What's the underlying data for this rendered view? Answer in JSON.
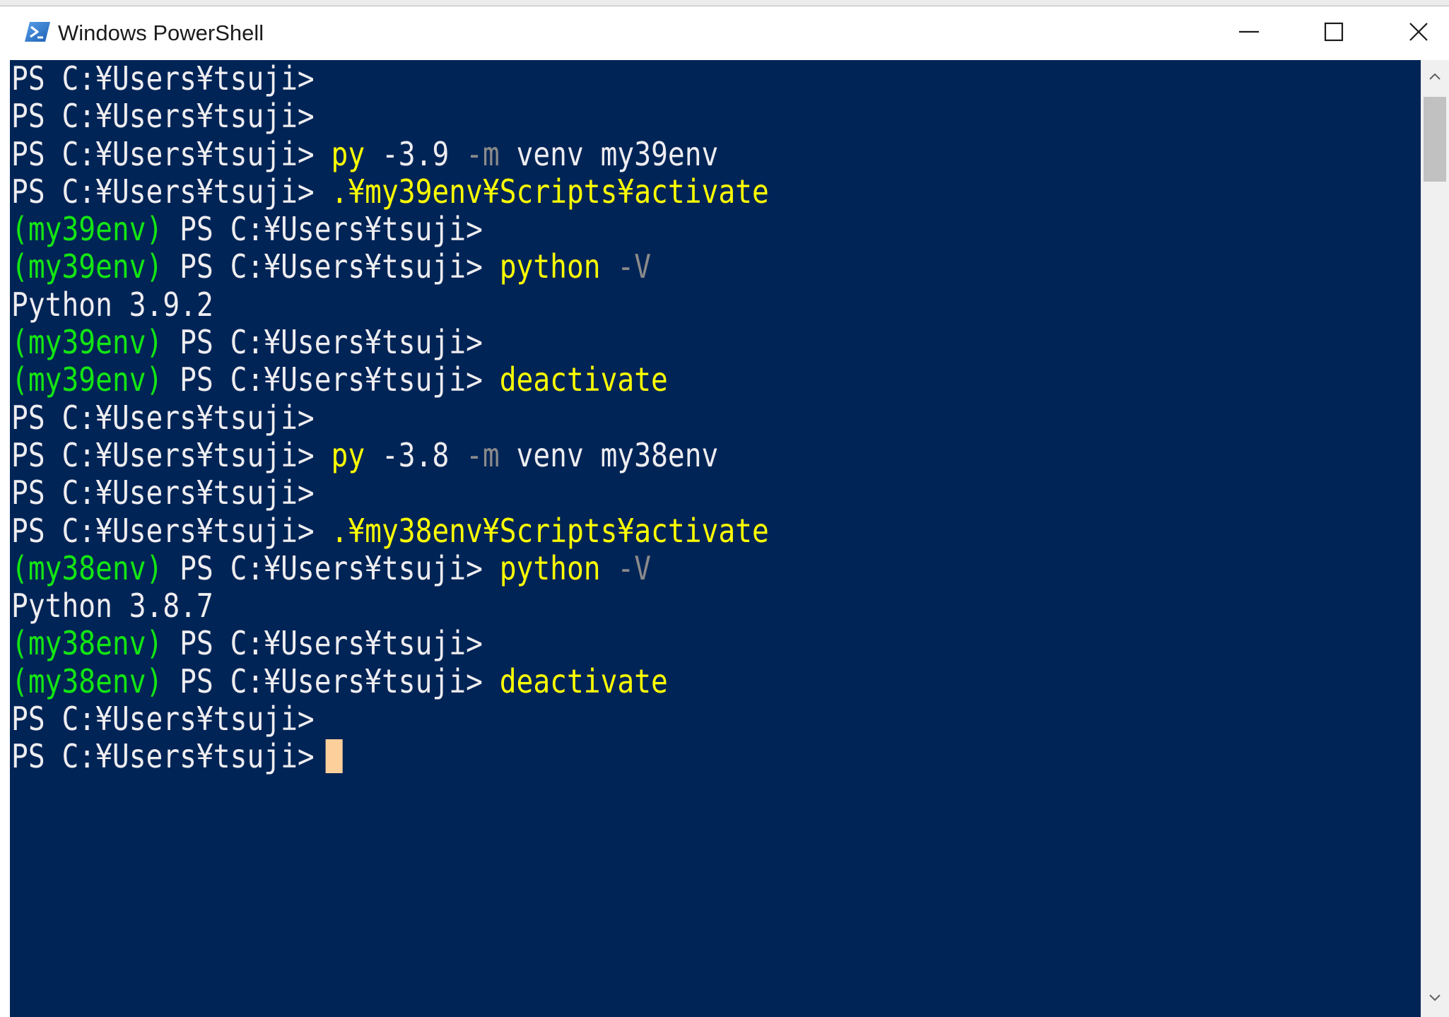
{
  "window": {
    "title": "Windows PowerShell",
    "icon": "powershell-icon",
    "controls": {
      "minimize_icon": "minimize-icon",
      "maximize_icon": "maximize-icon",
      "close_icon": "close-icon"
    }
  },
  "console": {
    "background": "#012456",
    "colors": {
      "default": "#eeedf0",
      "command": "#ffff00",
      "parameter": "#8a8a8a",
      "venv": "#13e613",
      "cursor": "#fdcf9b"
    },
    "lines": [
      [
        {
          "t": "PS C:¥Users¥tsuji>",
          "c": "white"
        }
      ],
      [
        {
          "t": "PS C:¥Users¥tsuji>",
          "c": "white"
        }
      ],
      [
        {
          "t": "PS C:¥Users¥tsuji> ",
          "c": "white"
        },
        {
          "t": "py",
          "c": "yellow"
        },
        {
          "t": " -3.9 ",
          "c": "white"
        },
        {
          "t": "-m",
          "c": "gray"
        },
        {
          "t": " venv my39env",
          "c": "white"
        }
      ],
      [
        {
          "t": "PS C:¥Users¥tsuji> ",
          "c": "white"
        },
        {
          "t": ".¥my39env¥Scripts¥activate",
          "c": "yellow"
        }
      ],
      [
        {
          "t": "(my39env)",
          "c": "green"
        },
        {
          "t": " PS C:¥Users¥tsuji>",
          "c": "white"
        }
      ],
      [
        {
          "t": "(my39env)",
          "c": "green"
        },
        {
          "t": " PS C:¥Users¥tsuji> ",
          "c": "white"
        },
        {
          "t": "python",
          "c": "yellow"
        },
        {
          "t": " ",
          "c": "white"
        },
        {
          "t": "-V",
          "c": "gray"
        }
      ],
      [
        {
          "t": "Python 3.9.2",
          "c": "white"
        }
      ],
      [
        {
          "t": "(my39env)",
          "c": "green"
        },
        {
          "t": " PS C:¥Users¥tsuji>",
          "c": "white"
        }
      ],
      [
        {
          "t": "(my39env)",
          "c": "green"
        },
        {
          "t": " PS C:¥Users¥tsuji> ",
          "c": "white"
        },
        {
          "t": "deactivate",
          "c": "yellow"
        }
      ],
      [
        {
          "t": "PS C:¥Users¥tsuji>",
          "c": "white"
        }
      ],
      [
        {
          "t": "PS C:¥Users¥tsuji> ",
          "c": "white"
        },
        {
          "t": "py",
          "c": "yellow"
        },
        {
          "t": " -3.8 ",
          "c": "white"
        },
        {
          "t": "-m",
          "c": "gray"
        },
        {
          "t": " venv my38env",
          "c": "white"
        }
      ],
      [
        {
          "t": "PS C:¥Users¥tsuji>",
          "c": "white"
        }
      ],
      [
        {
          "t": "PS C:¥Users¥tsuji> ",
          "c": "white"
        },
        {
          "t": ".¥my38env¥Scripts¥activate",
          "c": "yellow"
        }
      ],
      [
        {
          "t": "(my38env)",
          "c": "green"
        },
        {
          "t": " PS C:¥Users¥tsuji> ",
          "c": "white"
        },
        {
          "t": "python",
          "c": "yellow"
        },
        {
          "t": " ",
          "c": "white"
        },
        {
          "t": "-V",
          "c": "gray"
        }
      ],
      [
        {
          "t": "Python 3.8.7",
          "c": "white"
        }
      ],
      [
        {
          "t": "(my38env)",
          "c": "green"
        },
        {
          "t": " PS C:¥Users¥tsuji>",
          "c": "white"
        }
      ],
      [
        {
          "t": "(my38env)",
          "c": "green"
        },
        {
          "t": " PS C:¥Users¥tsuji> ",
          "c": "white"
        },
        {
          "t": "deactivate",
          "c": "yellow"
        }
      ],
      [
        {
          "t": "PS C:¥Users¥tsuji>",
          "c": "white"
        }
      ],
      [
        {
          "t": "PS C:¥Users¥tsuji>",
          "c": "white"
        }
      ]
    ],
    "cursor_line": 18
  },
  "scrollbar": {
    "up_icon": "scroll-up-arrow-icon",
    "down_icon": "scroll-down-arrow-icon"
  }
}
